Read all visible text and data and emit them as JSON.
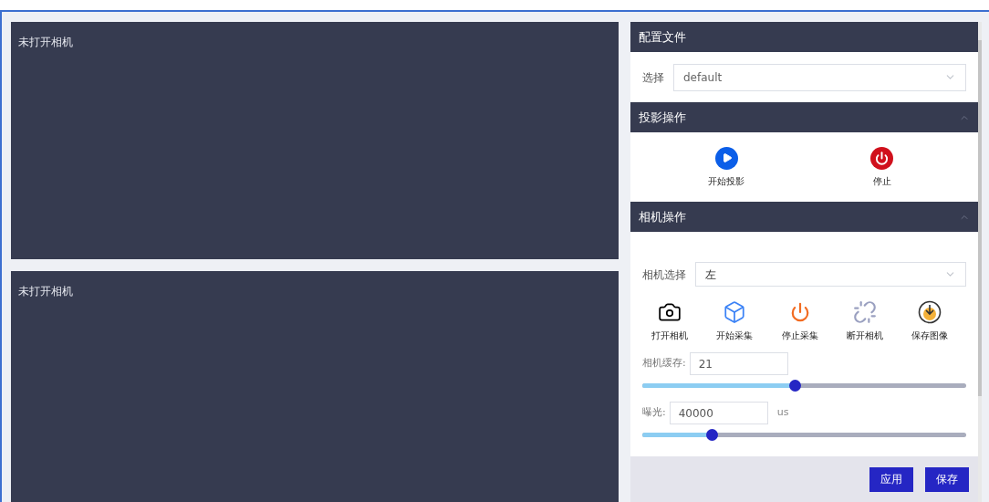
{
  "camera_views": [
    {
      "status": "未打开相机"
    },
    {
      "status": "未打开相机"
    }
  ],
  "config": {
    "title": "配置文件",
    "select_label": "选择",
    "select_value": "default"
  },
  "projection": {
    "title": "投影操作",
    "expanded": true,
    "actions": [
      {
        "kind": "play",
        "label": "开始投影"
      },
      {
        "kind": "stop",
        "label": "停止"
      }
    ]
  },
  "camera": {
    "title": "相机操作",
    "expanded": true,
    "select_label": "相机选择",
    "select_value": "左",
    "actions": [
      {
        "kind": "camera",
        "label": "打开相机"
      },
      {
        "kind": "capture",
        "label": "开始采集"
      },
      {
        "kind": "power",
        "label": "停止采集"
      },
      {
        "kind": "unlink",
        "label": "断开相机"
      },
      {
        "kind": "save",
        "label": "保存图像"
      }
    ],
    "params": [
      {
        "label": "相机缓存:",
        "value": "21",
        "level": 0.47
      },
      {
        "label": "曝光:",
        "value": "40000",
        "unit": "us",
        "level": 0.214
      }
    ]
  },
  "buttons": [
    "应用",
    "保存"
  ]
}
